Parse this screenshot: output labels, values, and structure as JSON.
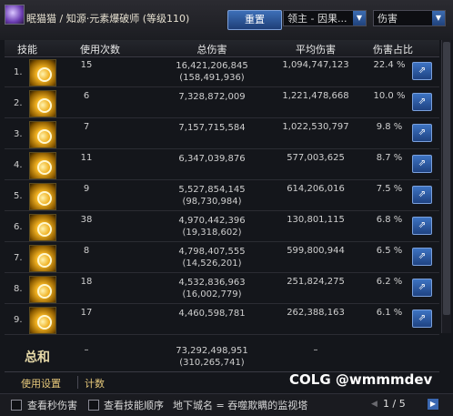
{
  "header": {
    "title": "眠猫猫 / 知源·元素爆破师 (等级110)",
    "reset_label": "重置",
    "dungeon_select": "领主 - 因果...",
    "metric_select": "伤害"
  },
  "columns": [
    "技能",
    "使用次数",
    "总伤害",
    "平均伤害",
    "伤害占比"
  ],
  "rows": [
    {
      "num": "1.",
      "count": "15",
      "total": "16,421,206,845",
      "total_sub": "(158,491,936)",
      "avg": "1,094,747,123",
      "pct": "22.4 %"
    },
    {
      "num": "2.",
      "count": "6",
      "total": "7,328,872,009",
      "total_sub": "",
      "avg": "1,221,478,668",
      "pct": "10.0 %"
    },
    {
      "num": "3.",
      "count": "7",
      "total": "7,157,715,584",
      "total_sub": "",
      "avg": "1,022,530,797",
      "pct": "9.8 %"
    },
    {
      "num": "4.",
      "count": "11",
      "total": "6,347,039,876",
      "total_sub": "",
      "avg": "577,003,625",
      "pct": "8.7 %"
    },
    {
      "num": "5.",
      "count": "9",
      "total": "5,527,854,145",
      "total_sub": "(98,730,984)",
      "avg": "614,206,016",
      "pct": "7.5 %"
    },
    {
      "num": "6.",
      "count": "38",
      "total": "4,970,442,396",
      "total_sub": "(19,318,602)",
      "avg": "130,801,115",
      "pct": "6.8 %"
    },
    {
      "num": "7.",
      "count": "8",
      "total": "4,798,407,555",
      "total_sub": "(14,526,201)",
      "avg": "599,800,944",
      "pct": "6.5 %"
    },
    {
      "num": "8.",
      "count": "18",
      "total": "4,532,836,963",
      "total_sub": "(16,002,779)",
      "avg": "251,824,275",
      "pct": "6.2 %"
    },
    {
      "num": "9.",
      "count": "17",
      "total": "4,460,598,781",
      "total_sub": "",
      "avg": "262,388,163",
      "pct": "6.1 %"
    }
  ],
  "summary": {
    "label": "总和",
    "count": "–",
    "total": "73,292,498,951",
    "total_sub": "(310,265,741)",
    "avg": "–"
  },
  "tabs": [
    "使用设置",
    "计数"
  ],
  "watermark": "COLG @wmmmdev",
  "footer": {
    "check1": "查看秒伤害",
    "check2": "查看技能顺序",
    "dungeon_text": "地下城名 = 吞噬欺瞒的监视塔",
    "page": "1 / 5"
  },
  "colors": {
    "accent": "#3d6fb8",
    "gold": "#e6c87a",
    "background": "#14161b"
  }
}
